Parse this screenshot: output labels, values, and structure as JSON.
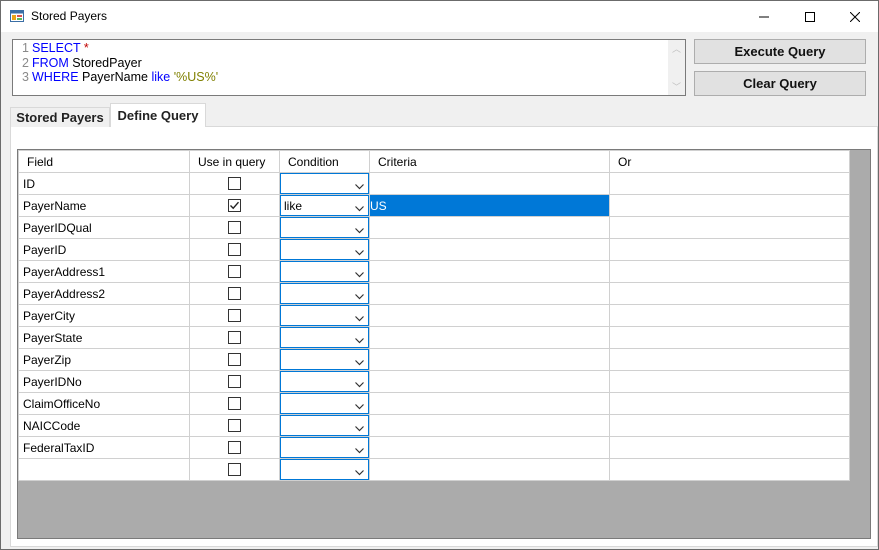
{
  "window": {
    "title": "Stored Payers"
  },
  "query": {
    "lines": [
      {
        "num": "1",
        "parts": [
          {
            "t": "SELECT",
            "c": "kw"
          },
          {
            "t": " ",
            "c": ""
          },
          {
            "t": "*",
            "c": "star"
          }
        ]
      },
      {
        "num": "2",
        "parts": [
          {
            "t": "FROM",
            "c": "kw"
          },
          {
            "t": " StoredPayer",
            "c": ""
          }
        ]
      },
      {
        "num": "3",
        "parts": [
          {
            "t": "WHERE",
            "c": "kw"
          },
          {
            "t": " PayerName ",
            "c": ""
          },
          {
            "t": "like",
            "c": "kw"
          },
          {
            "t": " ",
            "c": ""
          },
          {
            "t": "'%US%'",
            "c": "str"
          }
        ]
      }
    ]
  },
  "buttons": {
    "execute": "Execute Query",
    "clear": "Clear Query"
  },
  "tabs": [
    {
      "label": "Stored Payers",
      "active": false
    },
    {
      "label": "Define Query",
      "active": true
    }
  ],
  "grid": {
    "columns": [
      "Field",
      "Use in query",
      "Condition",
      "Criteria",
      "Or"
    ],
    "rows": [
      {
        "field": "ID",
        "use": false,
        "condition": "",
        "criteria": "",
        "or": ""
      },
      {
        "field": "PayerName",
        "use": true,
        "condition": "like",
        "criteria": "US",
        "or": "",
        "selected": true
      },
      {
        "field": "PayerIDQual",
        "use": false,
        "condition": "",
        "criteria": "",
        "or": ""
      },
      {
        "field": "PayerID",
        "use": false,
        "condition": "",
        "criteria": "",
        "or": ""
      },
      {
        "field": "PayerAddress1",
        "use": false,
        "condition": "",
        "criteria": "",
        "or": ""
      },
      {
        "field": "PayerAddress2",
        "use": false,
        "condition": "",
        "criteria": "",
        "or": ""
      },
      {
        "field": "PayerCity",
        "use": false,
        "condition": "",
        "criteria": "",
        "or": ""
      },
      {
        "field": "PayerState",
        "use": false,
        "condition": "",
        "criteria": "",
        "or": ""
      },
      {
        "field": "PayerZip",
        "use": false,
        "condition": "",
        "criteria": "",
        "or": ""
      },
      {
        "field": "PayerIDNo",
        "use": false,
        "condition": "",
        "criteria": "",
        "or": ""
      },
      {
        "field": "ClaimOfficeNo",
        "use": false,
        "condition": "",
        "criteria": "",
        "or": ""
      },
      {
        "field": "NAICCode",
        "use": false,
        "condition": "",
        "criteria": "",
        "or": ""
      },
      {
        "field": "FederalTaxID",
        "use": false,
        "condition": "",
        "criteria": "",
        "or": ""
      },
      {
        "field": "",
        "use": false,
        "condition": "",
        "criteria": "",
        "or": ""
      }
    ]
  },
  "colors": {
    "accent": "#0078d7",
    "keyword": "#0000ff",
    "string": "#808000",
    "star": "#c00000",
    "grid_background": "#ababab"
  }
}
